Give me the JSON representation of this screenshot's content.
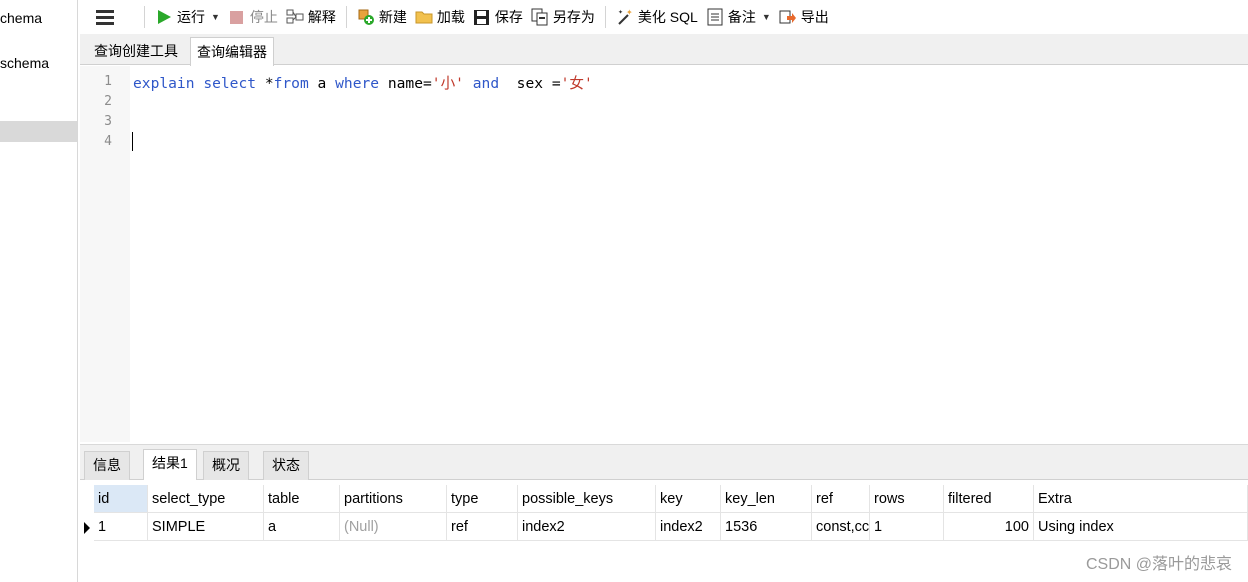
{
  "sidebar": {
    "items": [
      "chema",
      "schema"
    ]
  },
  "toolbar": {
    "menu_icon": "hamburger-icon",
    "run": "运行",
    "stop": "停止",
    "explain": "解释",
    "new": "新建",
    "load": "加载",
    "save": "保存",
    "save_as": "另存为",
    "beautify": "美化 SQL",
    "comment": "备注",
    "export": "导出"
  },
  "editor_tabs": [
    "查询创建工具",
    "查询编辑器"
  ],
  "editor": {
    "line_numbers": [
      "1",
      "2",
      "3",
      "4"
    ],
    "tokens": {
      "explain": "explain",
      "select": "select",
      "star": " *",
      "from": "from",
      "a": " a ",
      "where": "where",
      "name_eq": " name=",
      "str1": "'小'",
      "and": "and",
      "sex_eq": "  sex =",
      "str2": "'女'"
    }
  },
  "result_tabs": [
    "信息",
    "结果1",
    "概况",
    "状态"
  ],
  "grid": {
    "columns": [
      "id",
      "select_type",
      "table",
      "partitions",
      "type",
      "possible_keys",
      "key",
      "key_len",
      "ref",
      "rows",
      "filtered",
      "Extra"
    ],
    "rows": [
      [
        "1",
        "SIMPLE",
        "a",
        "(Null)",
        "ref",
        "index2",
        "index2",
        "1536",
        "const,cc",
        "1",
        "100",
        "Using index"
      ]
    ]
  },
  "watermark": "CSDN @落叶的悲哀",
  "colors": {
    "keyword": "#2f57c9",
    "string": "#c0392b",
    "run_icon": "#2aa82a",
    "stop_icon": "#d9a0a0"
  }
}
